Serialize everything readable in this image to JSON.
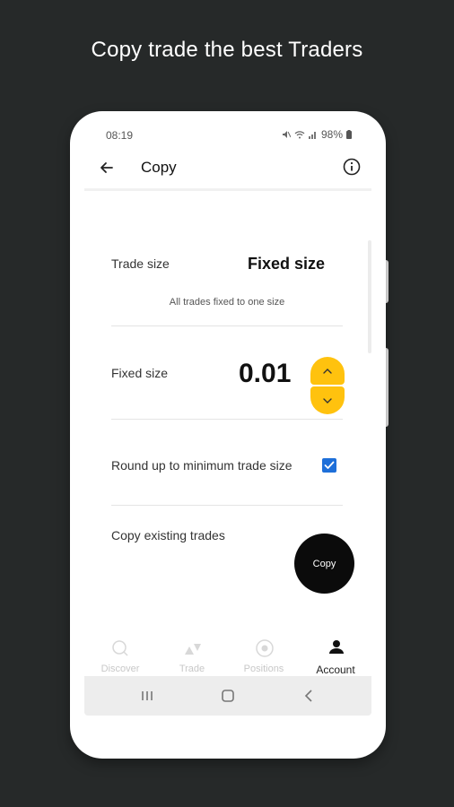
{
  "headline": "Copy trade the best Traders",
  "status_bar": {
    "time": "08:19",
    "battery": "98%"
  },
  "app_bar": {
    "title": "Copy"
  },
  "trade_size": {
    "label": "Trade size",
    "value": "Fixed size",
    "hint": "All trades fixed to one size"
  },
  "fixed_size": {
    "label": "Fixed size",
    "value": "0.01"
  },
  "round_up": {
    "label": "Round up to minimum trade size",
    "checked": true
  },
  "copy_existing": {
    "label": "Copy existing trades",
    "button_label": "Copy"
  },
  "bottom_nav": {
    "items": [
      {
        "label": "Discover",
        "icon": "search-icon",
        "active": false
      },
      {
        "label": "Trade",
        "icon": "trade-icon",
        "active": false
      },
      {
        "label": "Positions",
        "icon": "positions-icon",
        "active": false
      },
      {
        "label": "Account",
        "icon": "account-icon",
        "active": true
      }
    ]
  },
  "colors": {
    "background": "#262929",
    "accent": "#ffc20e",
    "checkbox": "#1e6fd9",
    "fab": "#0b0b0b"
  }
}
